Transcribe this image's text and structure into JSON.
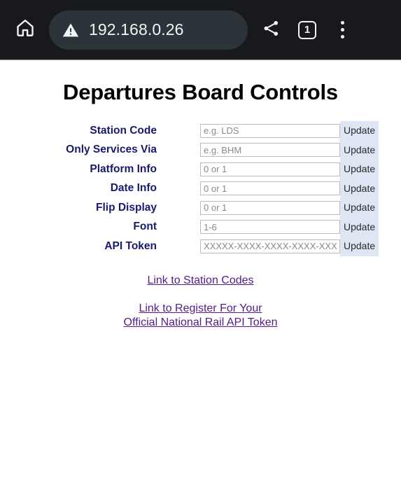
{
  "browser": {
    "home_icon": "home-icon",
    "security_icon": "warning-triangle-icon",
    "url": "192.168.0.26",
    "share_icon": "share-icon",
    "tab_count": "1",
    "menu_icon": "overflow-menu-icon"
  },
  "page": {
    "title": "Departures Board Controls",
    "update_label": "Update",
    "rows": [
      {
        "label": "Station Code",
        "placeholder": "e.g. LDS",
        "value": ""
      },
      {
        "label": "Only Services Via",
        "placeholder": "e.g. BHM",
        "value": ""
      },
      {
        "label": "Platform Info",
        "placeholder": "0 or 1",
        "value": ""
      },
      {
        "label": "Date Info",
        "placeholder": "0 or 1",
        "value": ""
      },
      {
        "label": "Flip Display",
        "placeholder": "0 or 1",
        "value": ""
      },
      {
        "label": "Font",
        "placeholder": "1-6",
        "value": ""
      },
      {
        "label": "API Token",
        "placeholder": "XXXXX-XXXX-XXXX-XXXX-XXXXXXXXXXXX",
        "value": ""
      }
    ],
    "links": {
      "station_codes": "Link to Station Codes",
      "api_token_line1": "Link to Register For Your",
      "api_token_line2": "Official National Rail API Token"
    }
  },
  "colors": {
    "toolbar_bg": "#17191c",
    "omnibox_bg": "#2b3539",
    "label_navy": "#191970",
    "button_blue": "#dee6f4",
    "link_purple": "#551a8b"
  }
}
